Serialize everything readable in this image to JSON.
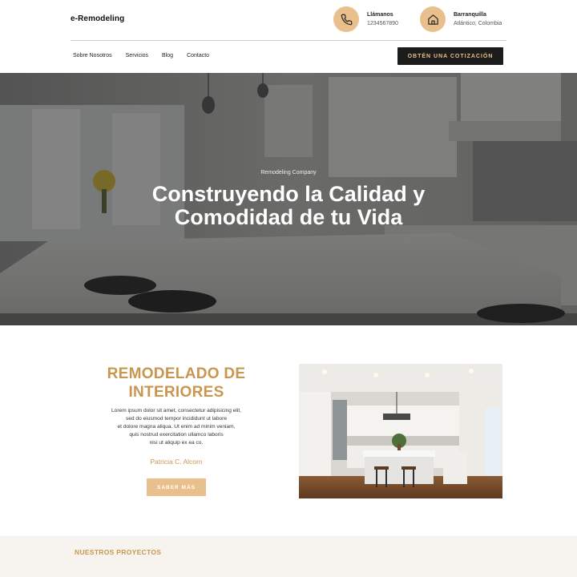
{
  "brand": {
    "logo": "e-Remodeling"
  },
  "contacts": {
    "phone": {
      "title": "Llámanos",
      "value": "1234567890",
      "icon": "phone-icon"
    },
    "location": {
      "title": "Barranquilla",
      "value": "Atlántico, Colombia",
      "icon": "home-icon"
    }
  },
  "nav": {
    "items": [
      {
        "label": "Sobre Nosotros"
      },
      {
        "label": "Servicios"
      },
      {
        "label": "Blog"
      },
      {
        "label": "Contacto"
      }
    ],
    "cta": "OBTÉN UNA COTIZACIÓN"
  },
  "hero": {
    "kicker": "Remodeling Company",
    "title_line1": "Construyendo la Calidad y",
    "title_line2": "Comodidad de tu Vida"
  },
  "feature": {
    "title_line1": "REMODELADO DE",
    "title_line2": "INTERIORES",
    "body": [
      "Lorem ipsum dolor sit amet, consectetur adipisicing elit,",
      "sed do eiusmod tempor incididunt ut labore",
      "et dolore magna aliqua. Ut enim ad minim veniam,",
      "quis nostrud exercitation ullamco laboris",
      "nisi ut aliquip ex ea co."
    ],
    "author": "Patricia C. Alcorn",
    "button": "SABER MÁS"
  },
  "projects": {
    "title": "NUESTROS PROYECTOS"
  },
  "colors": {
    "accent": "#c9964f",
    "accent_light": "#e9c08c",
    "dark": "#1c1c1c",
    "band": "#f7f4ef"
  }
}
